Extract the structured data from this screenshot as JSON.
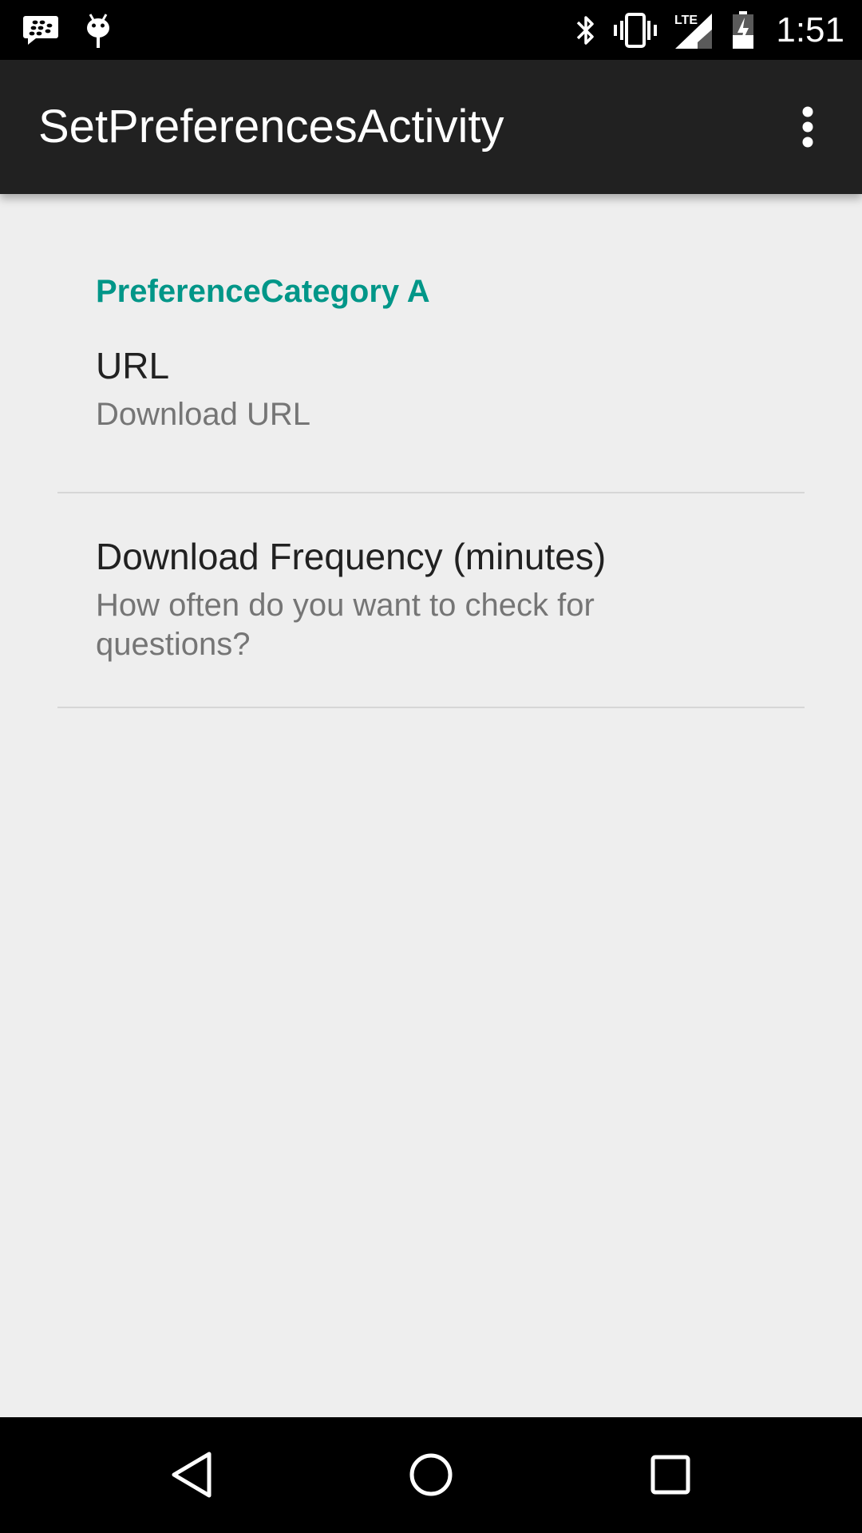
{
  "status_bar": {
    "time": "1:51",
    "network_label": "LTE",
    "left_icons": [
      "blackberry-messenger-icon",
      "android-debug-icon"
    ],
    "right_icons": [
      "bluetooth-icon",
      "vibrate-icon",
      "lte-signal-icon",
      "battery-icon"
    ]
  },
  "app_bar": {
    "title": "SetPreferencesActivity",
    "overflow_icon": "more-vert-icon"
  },
  "preferences": {
    "category_title": "PreferenceCategory A",
    "items": [
      {
        "title": "URL",
        "summary": "Download URL"
      },
      {
        "title": "Download Frequency (minutes)",
        "summary": "How often do you want to check for questions?"
      }
    ]
  },
  "nav_bar": {
    "icons": [
      "back-icon",
      "home-icon",
      "recents-icon"
    ]
  },
  "colors": {
    "status_bar": "#000000",
    "app_bar": "#212121",
    "background": "#eeeeee",
    "accent": "#009688",
    "primary_text": "#212121",
    "secondary_text": "#757575",
    "divider": "#d6d6d6"
  }
}
